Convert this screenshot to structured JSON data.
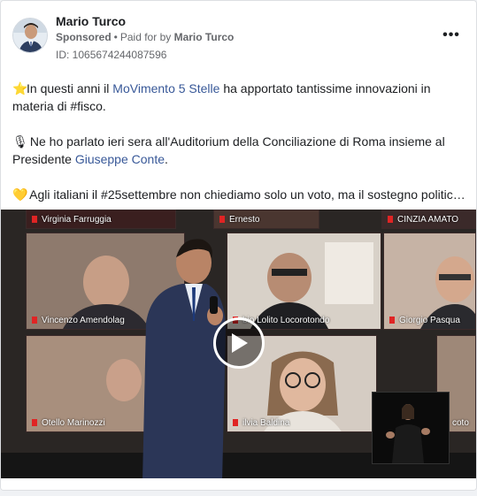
{
  "post": {
    "author": "Mario Turco",
    "sponsored_label": "Sponsored",
    "separator": "•",
    "paid_for_prefix": "Paid for by",
    "paid_for_name": "Mario Turco",
    "ad_id": "ID: 1065674244087596",
    "more_icon": "more-horizontal-icon",
    "more_label": "•••"
  },
  "body": {
    "p1": {
      "emoji": "⭐",
      "text_a": "In questi anni il ",
      "link": "MoVimento 5 Stelle",
      "text_b": " ha apportato tantissime innovazioni in materia di #fisco."
    },
    "p2": {
      "emoji": "🎙",
      "text_a": " Ne ho parlato ieri sera all'Auditorium della Conciliazione di Roma insieme al Presidente ",
      "link": "Giuseppe Conte",
      "text_b": "."
    },
    "p3": {
      "emoji": "💛",
      "text": " Agli italiani il #25settembre non chiediamo solo un voto, ma il sostegno politico..."
    }
  },
  "video": {
    "participants": [
      "Virginia Farruggia",
      "Ernesto",
      "CINZIA AMATO",
      "Vincenzo Amendolag",
      "bio Lolito Locorotondo",
      "Giorgio Pasqua",
      "Otello Marinozzi",
      "ilvia Baldina",
      "coto"
    ],
    "play_icon": "play-icon",
    "colors": {
      "accent_red": "#e02424",
      "link": "#385898"
    }
  }
}
